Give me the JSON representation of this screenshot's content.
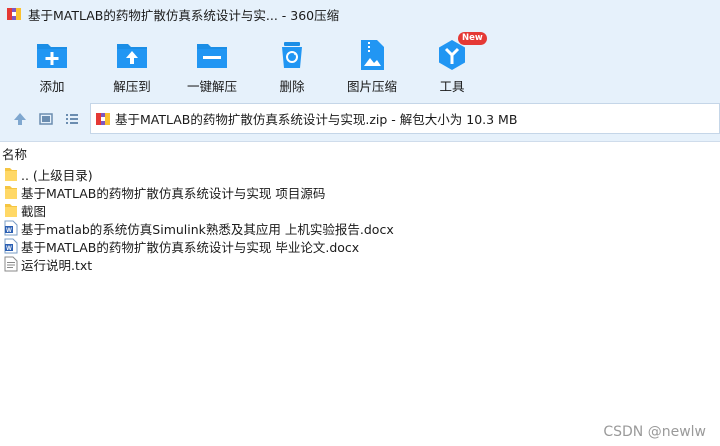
{
  "window": {
    "title": "基于MATLAB的药物扩散仿真系统设计与实... - 360压缩"
  },
  "toolbar": {
    "items": [
      {
        "label": "添加",
        "icon": "add-icon"
      },
      {
        "label": "解压到",
        "icon": "extract-to-icon"
      },
      {
        "label": "一键解压",
        "icon": "one-click-extract-icon"
      },
      {
        "label": "删除",
        "icon": "delete-icon"
      },
      {
        "label": "图片压缩",
        "icon": "image-compress-icon"
      },
      {
        "label": "工具",
        "icon": "tools-icon",
        "badge": "New"
      }
    ]
  },
  "addressbar": {
    "path": "基于MATLAB的药物扩散仿真系统设计与实现.zip - 解包大小为 10.3 MB"
  },
  "filelist": {
    "column_name": "名称",
    "items": [
      {
        "name": ".. (上级目录)",
        "type": "folder"
      },
      {
        "name": "基于MATLAB的药物扩散仿真系统设计与实现 项目源码",
        "type": "folder"
      },
      {
        "name": "截图",
        "type": "folder"
      },
      {
        "name": "基于matlab的系统仿真Simulink熟悉及其应用 上机实验报告.docx",
        "type": "docx"
      },
      {
        "name": "基于MATLAB的药物扩散仿真系统设计与实现 毕业论文.docx",
        "type": "docx"
      },
      {
        "name": "运行说明.txt",
        "type": "txt"
      }
    ]
  },
  "watermark": "CSDN @newlw",
  "colors": {
    "chrome_bg": "#e6f1fb",
    "icon_blue": "#1b8ee6",
    "folder_yellow": "#f5c542",
    "badge_red": "#e53935"
  }
}
